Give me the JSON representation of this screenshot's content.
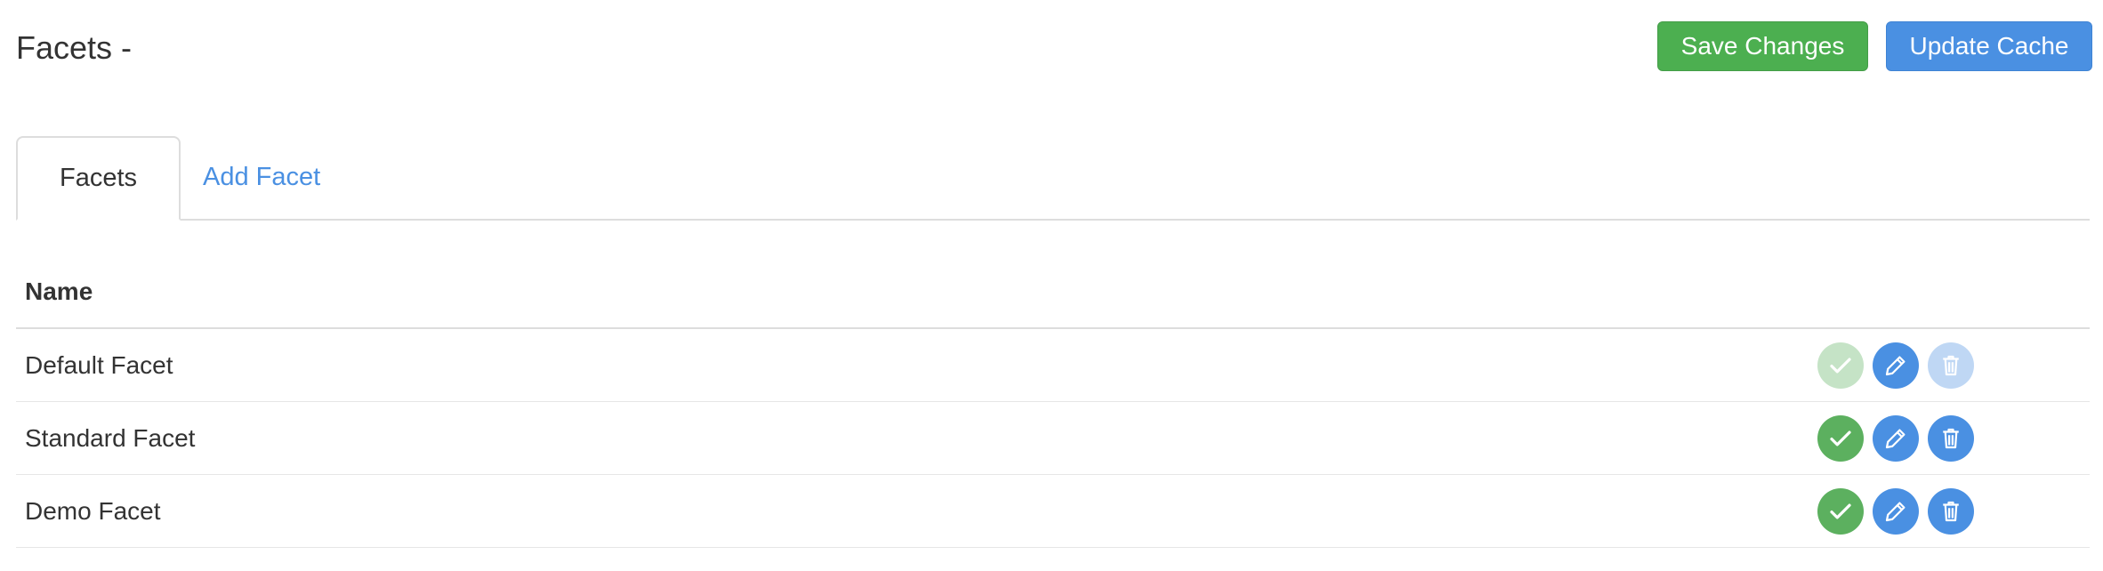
{
  "header": {
    "title": "Facets -",
    "save_label": "Save Changes",
    "update_label": "Update Cache"
  },
  "tabs": [
    {
      "label": "Facets",
      "active": true
    },
    {
      "label": "Add Facet",
      "active": false
    }
  ],
  "table": {
    "columns": [
      "Name"
    ],
    "rows": [
      {
        "name": "Default Facet",
        "enabled": false,
        "deletable": false
      },
      {
        "name": "Standard Facet",
        "enabled": true,
        "deletable": true
      },
      {
        "name": "Demo Facet",
        "enabled": true,
        "deletable": true
      }
    ]
  },
  "icons": {
    "activate": "check-icon",
    "edit": "pencil-icon",
    "delete": "trash-icon"
  },
  "colors": {
    "success": "#4caf50",
    "primary": "#4a90e2",
    "border": "#dddddd"
  }
}
